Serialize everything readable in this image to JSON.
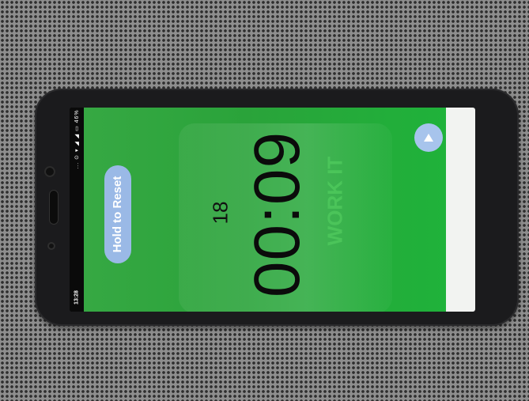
{
  "status_bar": {
    "time": "13:28",
    "icons_text": "... ⊙ ▾ ◢ ◢ ▭ 46%"
  },
  "workout": {
    "reset_label": "Hold to Reset",
    "round_count": "18",
    "timer": "00:09",
    "phase_label": "WORK IT",
    "play_icon": "play-icon"
  },
  "colors": {
    "screen_green": "#2aa33a",
    "button_blue": "#9ab9e6",
    "timer_text": "#0b0b0b"
  }
}
